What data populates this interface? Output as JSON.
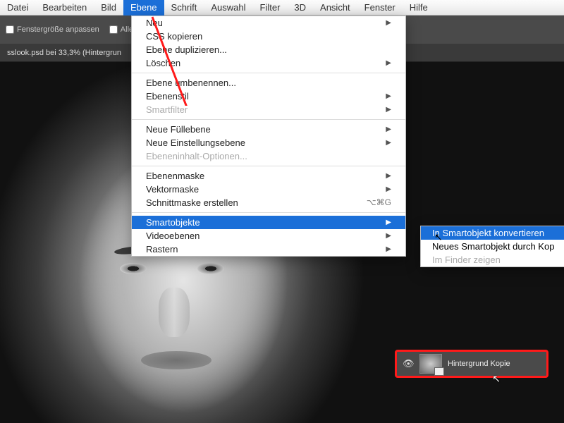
{
  "menubar": {
    "items": [
      "Datei",
      "Bearbeiten",
      "Bild",
      "Ebene",
      "Schrift",
      "Auswahl",
      "Filter",
      "3D",
      "Ansicht",
      "Fenster",
      "Hilfe"
    ],
    "active_index": 3
  },
  "toolbar": {
    "opt1": "Fenstergröße anpassen",
    "opt2": "Alle Fenster"
  },
  "tab": {
    "label": "sslook.psd bei 33,3% (Hintergrun"
  },
  "dropdown": {
    "groups": [
      [
        {
          "label": "Neu",
          "sub": true
        },
        {
          "label": "CSS kopieren"
        },
        {
          "label": "Ebene duplizieren..."
        },
        {
          "label": "Löschen",
          "sub": true
        }
      ],
      [
        {
          "label": "Ebene umbenennen..."
        },
        {
          "label": "Ebenenstil",
          "sub": true
        },
        {
          "label": "Smartfilter",
          "sub": true,
          "disabled": true
        }
      ],
      [
        {
          "label": "Neue Füllebene",
          "sub": true
        },
        {
          "label": "Neue Einstellungsebene",
          "sub": true
        },
        {
          "label": "Ebeneninhalt-Optionen...",
          "disabled": true
        }
      ],
      [
        {
          "label": "Ebenenmaske",
          "sub": true
        },
        {
          "label": "Vektormaske",
          "sub": true
        },
        {
          "label": "Schnittmaske erstellen",
          "shortcut": "⌥⌘G"
        }
      ],
      [
        {
          "label": "Smartobjekte",
          "sub": true,
          "highlight": true
        },
        {
          "label": "Videoebenen",
          "sub": true
        },
        {
          "label": "Rastern",
          "sub": true
        }
      ]
    ]
  },
  "submenu": {
    "items": [
      {
        "label": "In Smartobjekt konvertieren",
        "highlight": true
      },
      {
        "label": "Neues Smartobjekt durch Kop"
      },
      {
        "label": "Im Finder zeigen",
        "disabled": true
      }
    ]
  },
  "layer": {
    "name": "Hintergrund Kopie"
  },
  "annotation": {
    "color": "#ff1a1a"
  }
}
